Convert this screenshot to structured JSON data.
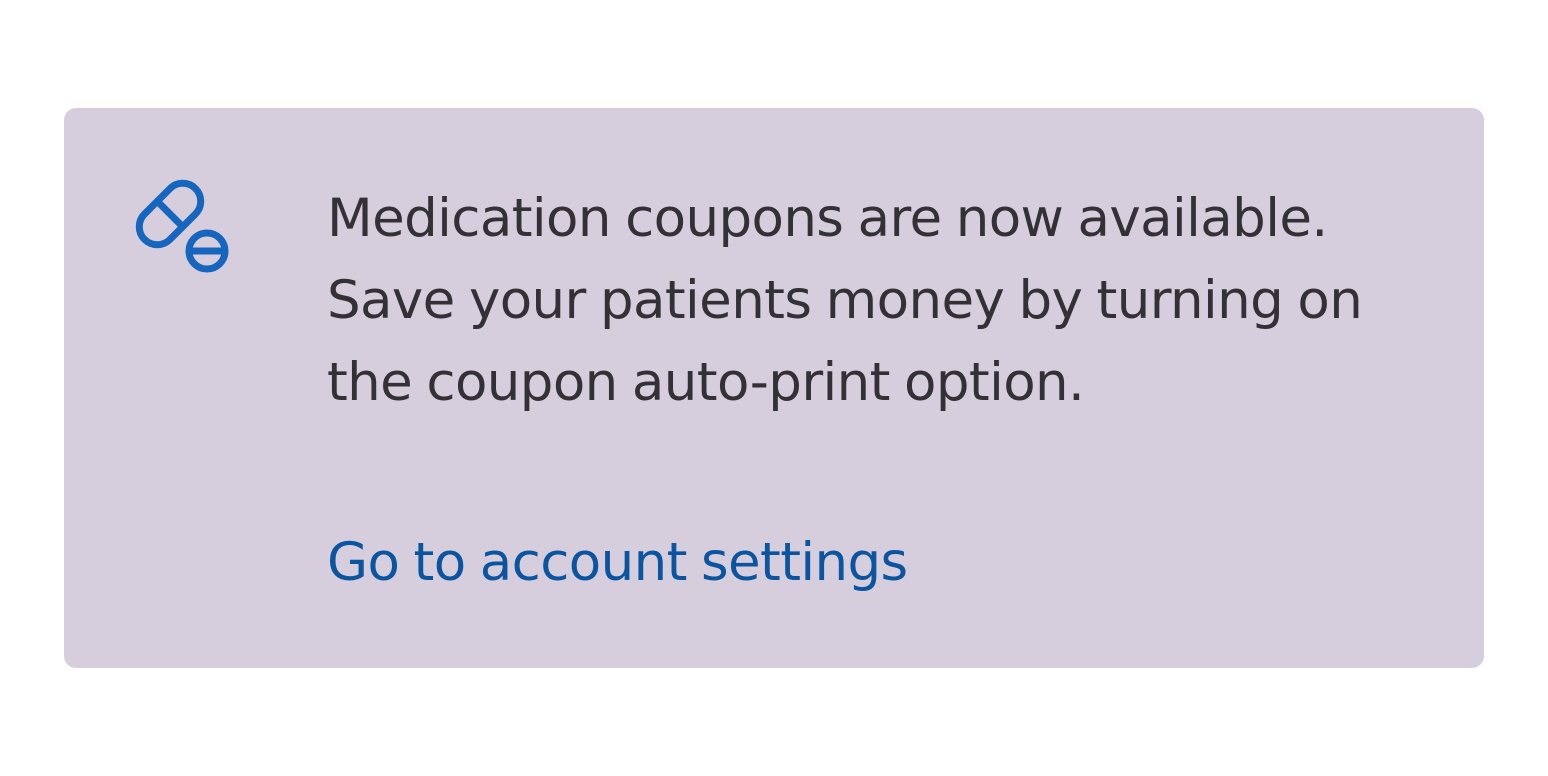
{
  "banner": {
    "background_color": "#d6cedd",
    "text_color": "#333136",
    "icon": "pill-icon",
    "icon_color": "#1666bf",
    "message_lines": [
      "Medication coupons are now available.",
      "Save your patients money by turning on",
      "the coupon auto-print option."
    ],
    "link_label": "Go to account settings",
    "link_color": "#0b54a0"
  }
}
